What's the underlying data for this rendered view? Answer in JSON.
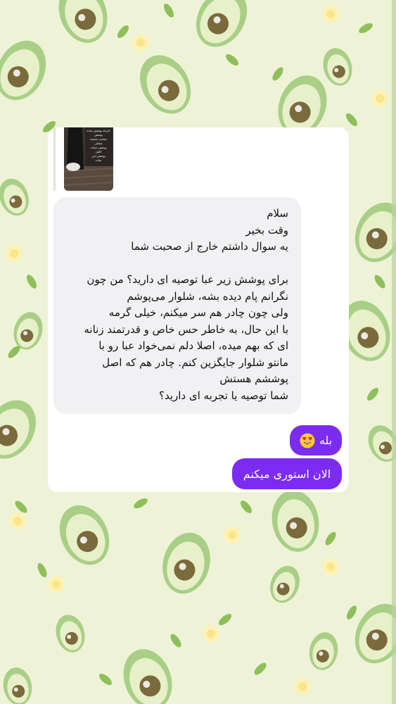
{
  "chat": {
    "attachment": {
      "kind": "image-thumbnail",
      "caption_lines": [
        "دلبرانه پوشش ساده",
        "پوشش",
        "مناسب محجبه",
        "مشکی",
        "پوشش حجاب",
        "کامل",
        "پوشش امن",
        "ساده"
      ]
    },
    "incoming": {
      "greeting": "سلام",
      "line2": "وقت بخیر",
      "line3": "یه سوال داشتم خارج از صحبت شما",
      "body": [
        "برای پوشش زیر عبا توصیه ای دارید؟ من چون",
        "نگرانم پام دیده بشه، شلوار می‌پوشم",
        "ولی چون چادر هم سر میکنم، خیلی گرمه",
        "با این حال، به خاطر حس خاص و قدرتمند زنانه",
        "ای که بهم میده، اصلا دلم نمی‌خواد عبا رو با",
        "مانتو شلوار جایگزین کنم. چادر هم که اصل",
        "پوششم هستش",
        "شما توصیه یا تجربه ای دارید؟"
      ]
    },
    "outgoing": {
      "reply1": "بله",
      "reply1_emoji": "heart-eyes-emoji",
      "reply2": "الان استوری میکنم"
    }
  },
  "theme": {
    "outgoing_bubble": "#7b2cf0",
    "incoming_bubble": "#f1f1f3",
    "wallpaper_base": "#eef3d8",
    "avocado_skin": "#a9cf86",
    "avocado_flesh": "#e7f0c8",
    "avocado_pit": "#7a6a3c"
  }
}
